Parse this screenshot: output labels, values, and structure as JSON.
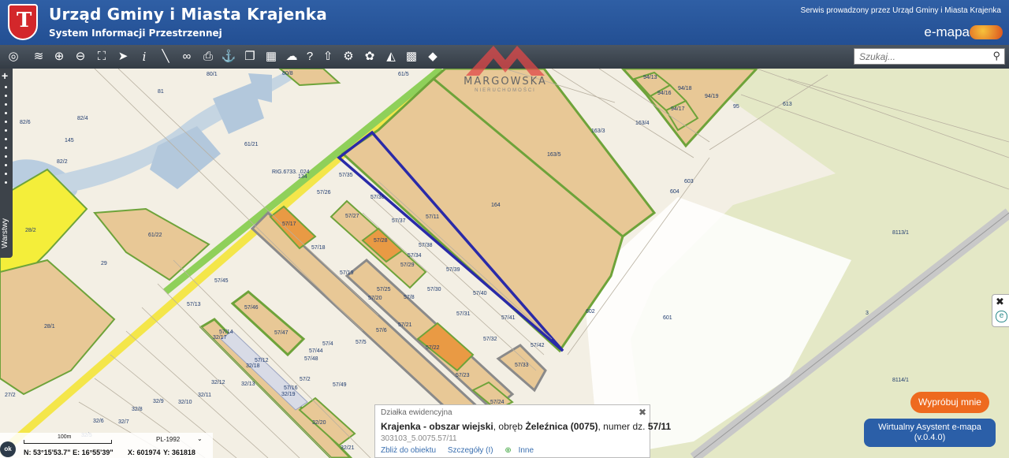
{
  "header": {
    "title": "Urząd Gminy i Miasta Krajenka",
    "subtitle": "System Informacji Przestrzennej",
    "service_note": "Serwis prowadzony przez Urząd Gminy i Miasta Krajenka",
    "brand": "e-mapa",
    "colors": {
      "header_bg": "#2a58a0",
      "crest_red": "#d3272b"
    }
  },
  "toolbar": {
    "icons": [
      "globe-icon",
      "layers-icon",
      "zoom-in-icon",
      "zoom-out-icon",
      "zoom-extent-icon",
      "pointer-icon",
      "info-icon",
      "measure-icon",
      "link-icon",
      "print-icon",
      "anchor-icon",
      "copy-icon",
      "table-icon",
      "comment-icon",
      "help-icon",
      "upload-icon",
      "settings-icon",
      "filter-icon",
      "perspective-icon",
      "colors-icon",
      "shapes-icon"
    ],
    "search_placeholder": "Szukaj..."
  },
  "sidebar": {
    "label": "Warstwy"
  },
  "watermark": {
    "name": "MARGOWSKA",
    "sub": "NIERUCHOMOŚCI"
  },
  "map": {
    "colors": {
      "background": "#f3efe4",
      "parcel_fill": "#e8c896",
      "parcel_border": "#6ea33a",
      "road_yellow": "#f4e64a",
      "road_green": "#9ccc4a",
      "highlight": "#2a2aa8",
      "water": "#b9cde0",
      "meadow": "#dfe6c4"
    },
    "labels": [
      {
        "t": "80/1"
      },
      {
        "t": "80/8"
      },
      {
        "t": "81"
      },
      {
        "t": "82/6"
      },
      {
        "t": "82/4"
      },
      {
        "t": "145"
      },
      {
        "t": "82/2"
      },
      {
        "t": "61/21"
      },
      {
        "t": "61/5"
      },
      {
        "t": "RIG.6733. .024"
      },
      {
        "t": "134"
      },
      {
        "t": "57/35"
      },
      {
        "t": "57/26"
      },
      {
        "t": "57/36"
      },
      {
        "t": "57/27"
      },
      {
        "t": "57/37"
      },
      {
        "t": "57/11"
      },
      {
        "t": "164"
      },
      {
        "t": "163/5"
      },
      {
        "t": "163/3"
      },
      {
        "t": "163/4"
      },
      {
        "t": "94/13"
      },
      {
        "t": "94/16"
      },
      {
        "t": "94/17"
      },
      {
        "t": "94/18"
      },
      {
        "t": "94/19"
      },
      {
        "t": "95"
      },
      {
        "t": "613"
      },
      {
        "t": "604"
      },
      {
        "t": "603"
      },
      {
        "t": "8113/1"
      },
      {
        "t": "28/2"
      },
      {
        "t": "61/22"
      },
      {
        "t": "29"
      },
      {
        "t": "57/17"
      },
      {
        "t": "57/28"
      },
      {
        "t": "57/38"
      },
      {
        "t": "57/34"
      },
      {
        "t": "57/29"
      },
      {
        "t": "57/18"
      },
      {
        "t": "57/39"
      },
      {
        "t": "57/19"
      },
      {
        "t": "57/45"
      },
      {
        "t": "57/25"
      },
      {
        "t": "57/30"
      },
      {
        "t": "57/40"
      },
      {
        "t": "57/20"
      },
      {
        "t": "57/8"
      },
      {
        "t": "57/13"
      },
      {
        "t": "57/46"
      },
      {
        "t": "28/1"
      },
      {
        "t": "57/31"
      },
      {
        "t": "57/41"
      },
      {
        "t": "602"
      },
      {
        "t": "601"
      },
      {
        "t": "57/21"
      },
      {
        "t": "57/47"
      },
      {
        "t": "57/14"
      },
      {
        "t": "32/17"
      },
      {
        "t": "57/4"
      },
      {
        "t": "57/5"
      },
      {
        "t": "57/6"
      },
      {
        "t": "57/32"
      },
      {
        "t": "57/42"
      },
      {
        "t": "3"
      },
      {
        "t": "57/44"
      },
      {
        "t": "57/22"
      },
      {
        "t": "57/12"
      },
      {
        "t": "32/18"
      },
      {
        "t": "57/48"
      },
      {
        "t": "57/33"
      },
      {
        "t": "57/23"
      },
      {
        "t": "32/12"
      },
      {
        "t": "32/13"
      },
      {
        "t": "57/2"
      },
      {
        "t": "57/49"
      },
      {
        "t": "57/16"
      },
      {
        "t": "27/2"
      },
      {
        "t": "32/11"
      },
      {
        "t": "32/19"
      },
      {
        "t": "8114/1"
      },
      {
        "t": "32/9"
      },
      {
        "t": "32/10"
      },
      {
        "t": "57/24"
      },
      {
        "t": "32/8"
      },
      {
        "t": "32/7"
      },
      {
        "t": "32/6"
      },
      {
        "t": "32/20"
      },
      {
        "t": "32/5"
      },
      {
        "t": "32/21"
      }
    ]
  },
  "popup": {
    "header": "Działka ewidencyjna",
    "loc_bold": "Krajenka - obszar wiejski",
    "loc_mid": ", obręb ",
    "obreb": "Żeleźnica (0075)",
    "num_prefix": ", numer dz. ",
    "number": "57/11",
    "identifier": "303103_5.0075.57/11",
    "links": {
      "zoom": "Zbliż do obiektu",
      "details": "Szczegóły (I)",
      "plus": "⊕",
      "other": "Inne"
    },
    "close": "✖"
  },
  "assistant": {
    "try": "Wypróbuj mnie",
    "title": "Wirtualny Asystent e-mapa",
    "version": "(v.0.4.0)"
  },
  "coords": {
    "scale": "100m",
    "crs": "PL-1992",
    "n": "N: 53°15'53.7\"",
    "e": "E: 16°55'39\"",
    "x": "X: 601974",
    "y": "Y: 361818",
    "ok": "ok"
  }
}
